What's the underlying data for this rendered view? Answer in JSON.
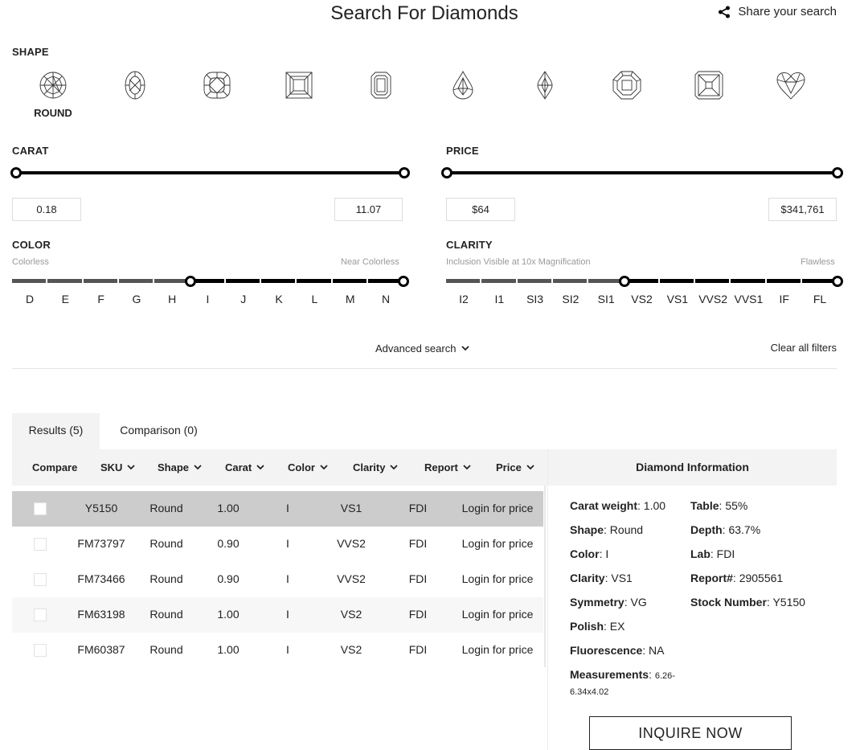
{
  "page": {
    "title": "Search For Diamonds",
    "share_label": "Share your search"
  },
  "shape": {
    "label": "SHAPE",
    "selected": "ROUND",
    "items": [
      {
        "icon": "round-diamond-icon"
      },
      {
        "icon": "oval-diamond-icon"
      },
      {
        "icon": "cushion-diamond-icon"
      },
      {
        "icon": "princess-diamond-icon"
      },
      {
        "icon": "emerald-diamond-icon"
      },
      {
        "icon": "pear-diamond-icon"
      },
      {
        "icon": "marquise-diamond-icon"
      },
      {
        "icon": "asscher-diamond-icon"
      },
      {
        "icon": "radiant-diamond-icon"
      },
      {
        "icon": "heart-diamond-icon"
      }
    ]
  },
  "carat": {
    "label": "CARAT",
    "min": "0.18",
    "max": "11.07"
  },
  "price": {
    "label": "PRICE",
    "min": "$64",
    "max": "$341,761"
  },
  "color": {
    "label": "COLOR",
    "left_caption": "Colorless",
    "right_caption": "Near Colorless",
    "grades": [
      "D",
      "E",
      "F",
      "G",
      "H",
      "I",
      "J",
      "K",
      "L",
      "M",
      "N"
    ],
    "selected_from_index": 5
  },
  "clarity": {
    "label": "CLARITY",
    "left_caption": "Inclusion Visible at 10x Magnification",
    "right_caption": "Flawless",
    "grades": [
      "I2",
      "I1",
      "SI3",
      "SI2",
      "SI1",
      "VS2",
      "VS1",
      "VVS2",
      "VVS1",
      "IF",
      "FL"
    ],
    "selected_from_index": 5
  },
  "filters": {
    "advanced_label": "Advanced search",
    "clear_label": "Clear all filters"
  },
  "tabs": [
    {
      "label": "Results (5)",
      "active": true
    },
    {
      "label": "Comparison (0)",
      "active": false
    }
  ],
  "table": {
    "headers": [
      "Compare",
      "SKU",
      "Shape",
      "Carat",
      "Color",
      "Clarity",
      "Report",
      "Price"
    ],
    "rows": [
      {
        "sku": "Y5150",
        "shape": "Round",
        "carat": "1.00",
        "color": "I",
        "clarity": "VS1",
        "report": "FDI",
        "price": "Login for price"
      },
      {
        "sku": "FM73797",
        "shape": "Round",
        "carat": "0.90",
        "color": "I",
        "clarity": "VVS2",
        "report": "FDI",
        "price": "Login for price"
      },
      {
        "sku": "FM73466",
        "shape": "Round",
        "carat": "0.90",
        "color": "I",
        "clarity": "VVS2",
        "report": "FDI",
        "price": "Login for price"
      },
      {
        "sku": "FM63198",
        "shape": "Round",
        "carat": "1.00",
        "color": "I",
        "clarity": "VS2",
        "report": "FDI",
        "price": "Login for price"
      },
      {
        "sku": "FM60387",
        "shape": "Round",
        "carat": "1.00",
        "color": "I",
        "clarity": "VS2",
        "report": "FDI",
        "price": "Login for price"
      }
    ]
  },
  "info": {
    "title": "Diamond Information",
    "left": [
      {
        "label": "Carat weight",
        "value": "1.00"
      },
      {
        "label": "Shape",
        "value": "Round"
      },
      {
        "label": "Color",
        "value": "I"
      },
      {
        "label": "Clarity",
        "value": "VS1"
      },
      {
        "label": "Symmetry",
        "value": "VG"
      },
      {
        "label": "Polish",
        "value": "EX"
      },
      {
        "label": "Fluorescence",
        "value": "NA"
      }
    ],
    "right": [
      {
        "label": "Table",
        "value": "55%"
      },
      {
        "label": "Depth",
        "value": "63.7%"
      },
      {
        "label": "Lab",
        "value": "FDI"
      },
      {
        "label": "Report#",
        "value": "2905561"
      },
      {
        "label": "Stock Number",
        "value": "Y5150"
      }
    ],
    "measurements_label": "Measurements",
    "measurements_line1": "6.26-",
    "measurements_line2": "6.34x4.02",
    "inquire_label": "INQUIRE NOW"
  }
}
